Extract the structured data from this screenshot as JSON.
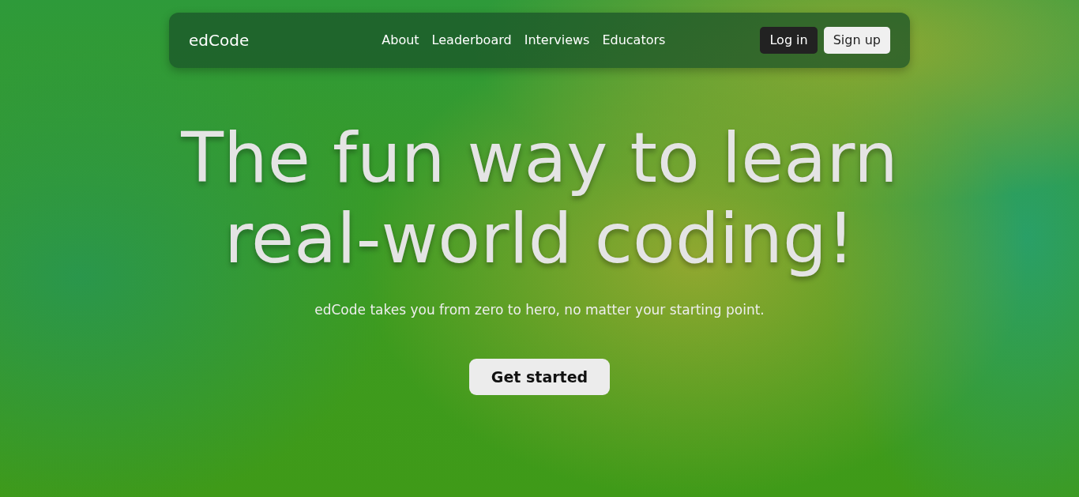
{
  "navbar": {
    "brand": "edCode",
    "links": [
      {
        "label": "About"
      },
      {
        "label": "Leaderboard"
      },
      {
        "label": "Interviews"
      },
      {
        "label": "Educators"
      }
    ],
    "buttons": [
      {
        "label": "Log in",
        "kind": "dark"
      },
      {
        "label": "Sign up",
        "kind": "light"
      }
    ]
  },
  "hero": {
    "title_lines": [
      "The fun way to learn",
      "real-world coding!"
    ],
    "subtitle": "edCode takes you from zero to hero, no matter your starting point.",
    "cta": "Get started"
  }
}
